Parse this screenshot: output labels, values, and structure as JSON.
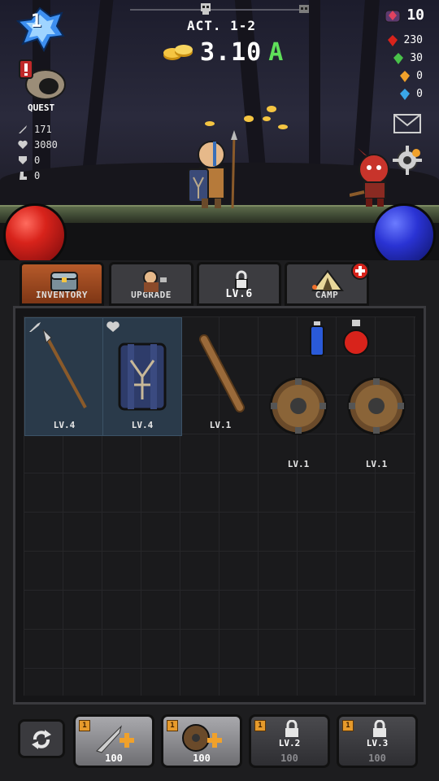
{
  "hud": {
    "player_level": "1",
    "act": "ACT. 1-2",
    "gold_amount": "3.10",
    "gold_unit": "A",
    "quest_label": "QUEST"
  },
  "stats": {
    "attack": "171",
    "health": "3080",
    "defense": "0",
    "speed": "0"
  },
  "resources": {
    "gem_total": "10",
    "red": "230",
    "green": "30",
    "orange": "0",
    "blue": "0"
  },
  "tabs": {
    "inventory": "INVENTORY",
    "upgrade": "UPGRADE",
    "locked": "LV.6",
    "camp": "CAMP"
  },
  "inventory": {
    "slots": [
      {
        "item": "spear",
        "level": "LV.4",
        "equipped": true
      },
      {
        "item": "shield",
        "level": "LV.4",
        "equipped": true
      },
      {
        "item": "club",
        "level": "LV.1",
        "equipped": false
      },
      {
        "item": "wooden-buckler",
        "level": "LV.1",
        "equipped": false
      },
      {
        "item": "wooden-buckler",
        "level": "LV.1",
        "equipped": false
      }
    ]
  },
  "shop": {
    "buttons": [
      {
        "badge": "1",
        "cost": "100",
        "locked": false
      },
      {
        "badge": "1",
        "cost": "100",
        "locked": false
      },
      {
        "badge": "1",
        "cost": "100",
        "locked": true,
        "unlock_level": "LV.2"
      },
      {
        "badge": "1",
        "cost": "100",
        "locked": true,
        "unlock_level": "LV.3"
      }
    ]
  },
  "colors": {
    "gold": "#f5c542",
    "gold_unit": "#5fe05a",
    "hp": "#d8231b",
    "mp": "#2a33d4",
    "active_tab": "#b65a2a"
  }
}
